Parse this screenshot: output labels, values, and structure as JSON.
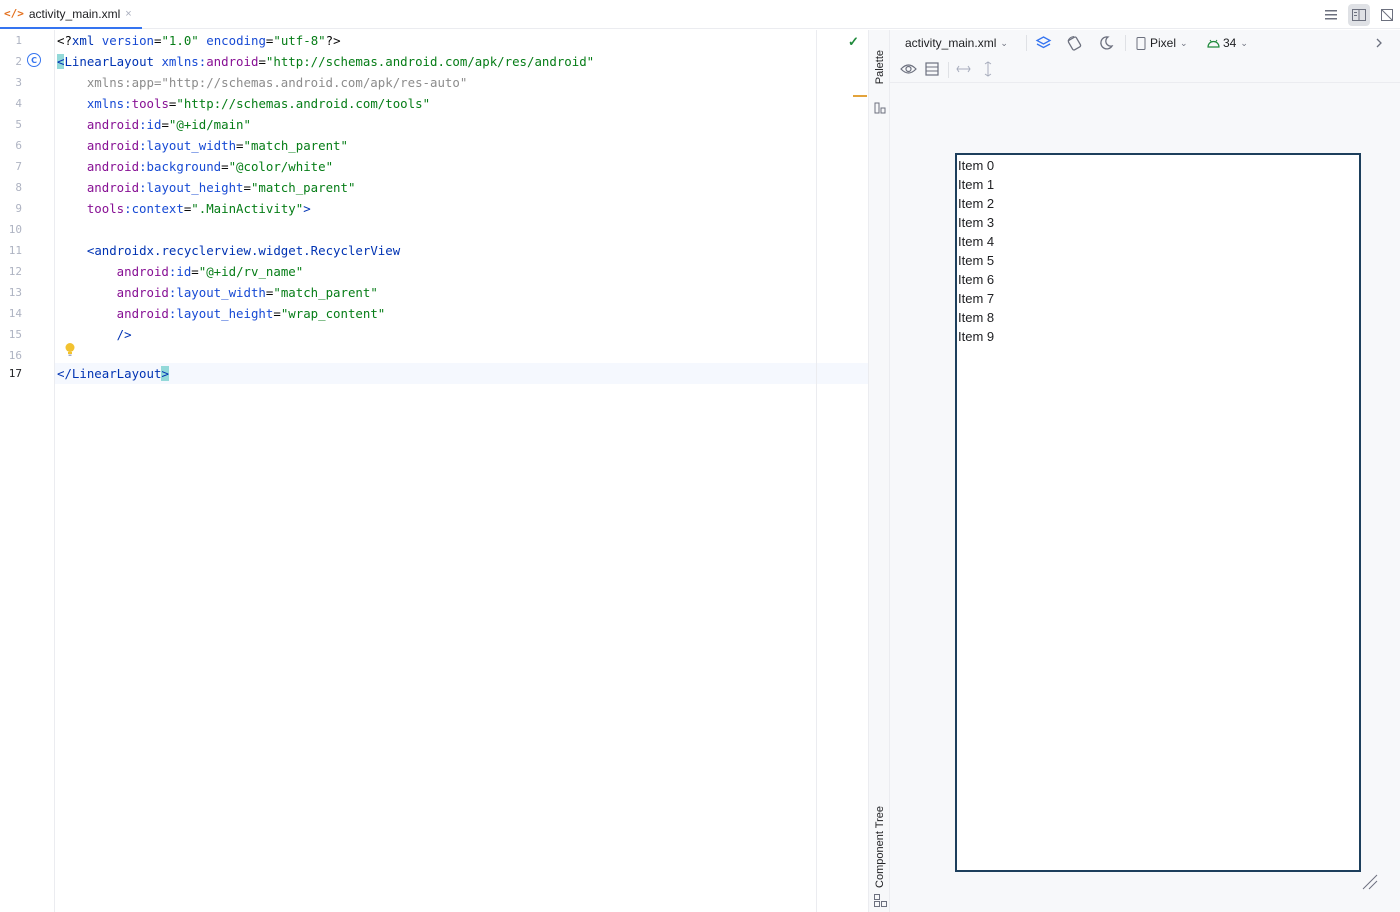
{
  "tab": {
    "icon": "</>",
    "title": "activity_main.xml",
    "close": "×"
  },
  "gutter": {
    "line_numbers": [
      "1",
      "2",
      "3",
      "4",
      "5",
      "6",
      "7",
      "8",
      "9",
      "10",
      "11",
      "12",
      "13",
      "14",
      "15",
      "16",
      "17"
    ]
  },
  "code": {
    "l1": {
      "a": "<?",
      "b": "xml",
      "c": " version",
      "d": "=",
      "e": "\"1.0\"",
      "f": " encoding",
      "g": "=",
      "h": "\"utf-8\"",
      "i": "?>"
    },
    "l2": {
      "a": "<",
      "b": "LinearLayout",
      "c": " xmlns:",
      "d": "android",
      "e": "=",
      "f": "\"http://schemas.android.com/apk/res/android\""
    },
    "l3": {
      "a": "    xmlns:app=\"http://schemas.android.com/apk/res-auto\""
    },
    "l4": {
      "a": "    xmlns:",
      "b": "tools",
      "c": "=",
      "d": "\"http://schemas.android.com/tools\""
    },
    "l5": {
      "a": "    android",
      "b": ":id",
      "c": "=",
      "d": "\"@+id/main\""
    },
    "l6": {
      "a": "    android",
      "b": ":layout_width",
      "c": "=",
      "d": "\"match_parent\""
    },
    "l7": {
      "a": "    android",
      "b": ":background",
      "c": "=",
      "d": "\"@color/white\""
    },
    "l8": {
      "a": "    android",
      "b": ":layout_height",
      "c": "=",
      "d": "\"match_parent\""
    },
    "l9": {
      "a": "    tools",
      "b": ":context",
      "c": "=",
      "d": "\".MainActivity\"",
      "e": ">"
    },
    "l11": {
      "a": "    <",
      "b": "androidx.recyclerview.widget.RecyclerView"
    },
    "l12": {
      "a": "        android",
      "b": ":id",
      "c": "=",
      "d": "\"@+id/rv_name\""
    },
    "l13": {
      "a": "        android",
      "b": ":layout_width",
      "c": "=",
      "d": "\"match_parent\""
    },
    "l14": {
      "a": "        android",
      "b": ":layout_height",
      "c": "=",
      "d": "\"wrap_content\""
    },
    "l15": {
      "a": "        />"
    },
    "l17": {
      "a": "</",
      "b": "LinearLayout",
      "c": ">"
    }
  },
  "gutter_marker": "C",
  "side_tabs": {
    "palette": "Palette",
    "component_tree": "Component Tree"
  },
  "design_toolbar": {
    "file": "activity_main.xml",
    "device": "Pixel",
    "api": "34"
  },
  "recycler_items": [
    "Item 0",
    "Item 1",
    "Item 2",
    "Item 3",
    "Item 4",
    "Item 5",
    "Item 6",
    "Item 7",
    "Item 8",
    "Item 9"
  ],
  "colors": {
    "accent": "#3574f0",
    "device_border": "#1d3f5c",
    "string": "#067d17",
    "tag": "#0033b3",
    "attr_ns": "#871094",
    "bracket_highlight": "#93d9d9"
  }
}
